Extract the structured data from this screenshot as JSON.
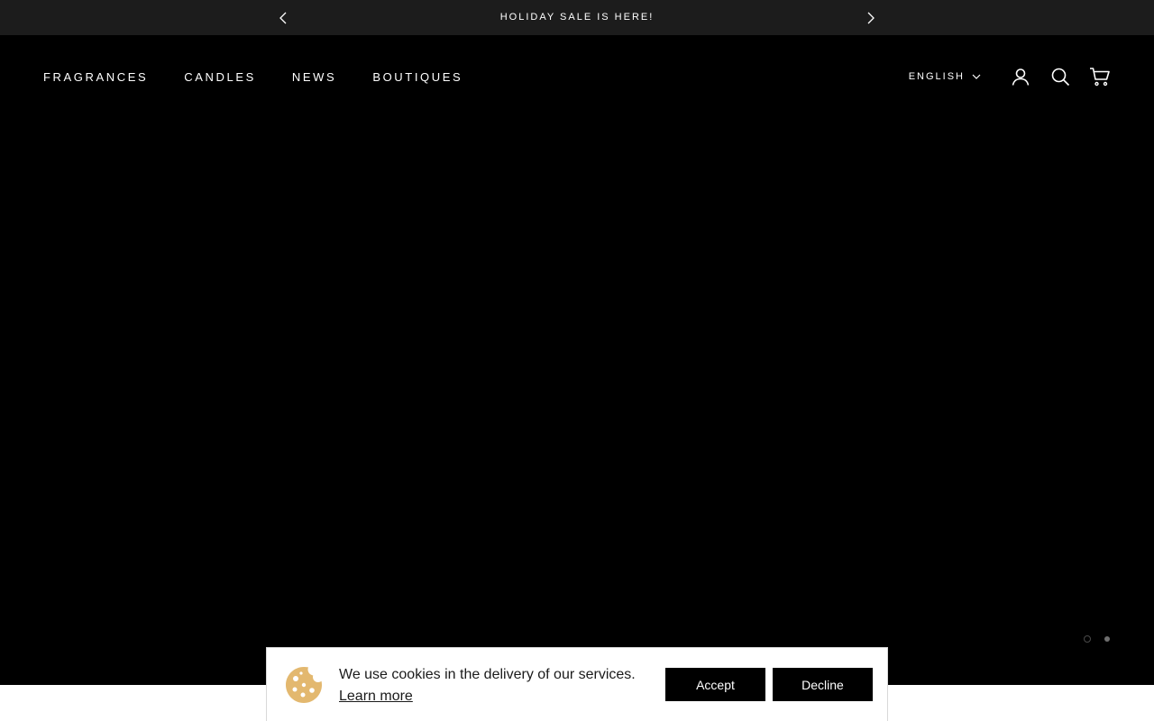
{
  "announcement": {
    "text": "HOLIDAY SALE IS HERE!",
    "prev_icon": "chevron-left-icon",
    "next_icon": "chevron-right-icon"
  },
  "nav": {
    "items": [
      {
        "label": "FRAGRANCES"
      },
      {
        "label": "CANDLES"
      },
      {
        "label": "NEWS"
      },
      {
        "label": "BOUTIQUES"
      }
    ]
  },
  "header_right": {
    "language": "ENGLISH",
    "icons": [
      "user-icon",
      "search-icon",
      "cart-icon"
    ]
  },
  "slider": {
    "slide_count": 2,
    "active_slide": 1
  },
  "cookie_banner": {
    "message": "We use cookies in the delivery of our services.",
    "learn_more": "Learn more",
    "accept": "Accept",
    "decline": "Decline",
    "icon": "cookie-icon",
    "icon_color": "#e3b86f"
  },
  "colors": {
    "announcement_bg": "#1c1c1c",
    "hero_bg": "#000000",
    "button_bg": "#000000"
  }
}
